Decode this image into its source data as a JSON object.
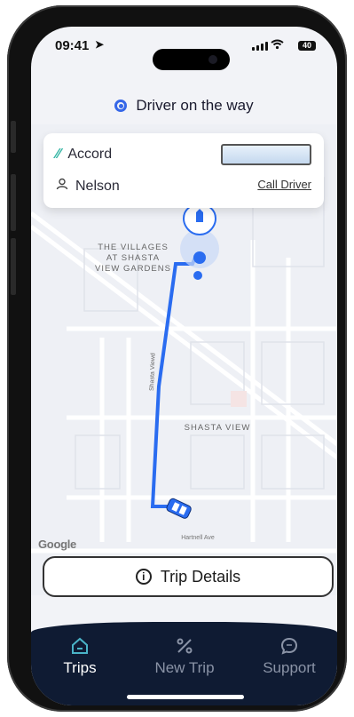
{
  "status_bar": {
    "time": "09:41",
    "battery": "40"
  },
  "header": {
    "status_text": "Driver on the way"
  },
  "driver_card": {
    "vehicle_model": "Accord",
    "driver_name": "Nelson",
    "call_label": "Call Driver"
  },
  "map": {
    "area_label_villages_1": "THE VILLAGES",
    "area_label_villages_2": "AT SHASTA",
    "area_label_villages_3": "VIEW GARDENS",
    "area_label_shasta_view": "SHASTA VIEW",
    "street_label_shasta": "Shasta Viewd",
    "street_label_hartnell": "Hartnell Ave",
    "attribution": "Google",
    "route_color": "#2a6cf0"
  },
  "actions": {
    "trip_details_label": "Trip Details"
  },
  "tabs": [
    {
      "label": "Trips",
      "icon": "home-icon",
      "active": true
    },
    {
      "label": "New Trip",
      "icon": "new-trip-icon",
      "active": false
    },
    {
      "label": "Support",
      "icon": "chat-bubble-icon",
      "active": false
    }
  ],
  "colors": {
    "accent": "#3667e8",
    "tab_bar": "#0f1b33",
    "active_tab": "#4ab3c7"
  }
}
